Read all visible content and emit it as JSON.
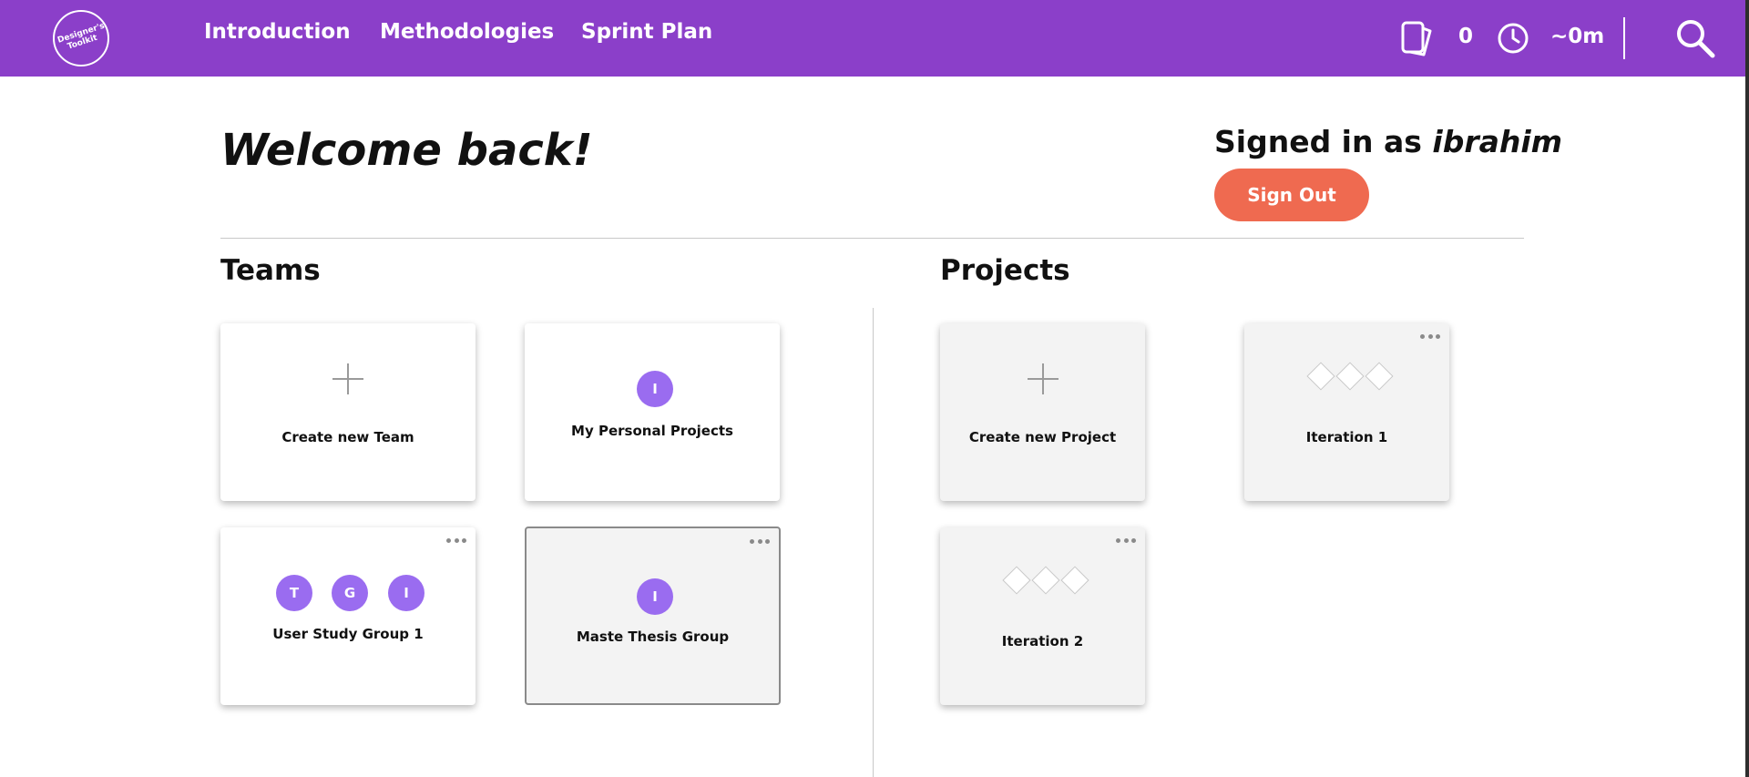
{
  "header": {
    "logo_text": "Designer's Toolkit",
    "nav": [
      "Introduction",
      "Methodologies",
      "Sprint Plan"
    ],
    "card_count": "0",
    "time_estimate": "~0m",
    "icons": [
      "cards-icon",
      "clock-icon",
      "search-icon"
    ]
  },
  "welcome": {
    "title": "Welcome back!",
    "signed_in_prefix": "Signed in as ",
    "username": "ibrahim",
    "sign_out_label": "Sign Out"
  },
  "teams": {
    "title": "Teams",
    "create_label": "Create new Team",
    "items": [
      {
        "name": "My Personal Projects",
        "members": [
          "I"
        ]
      },
      {
        "name": "User Study Group 1",
        "members": [
          "T",
          "G",
          "I"
        ]
      },
      {
        "name": "Maste Thesis Group",
        "members": [
          "I"
        ],
        "selected": true
      }
    ]
  },
  "projects": {
    "title": "Projects",
    "create_label": "Create new Project",
    "items": [
      {
        "name": "Iteration 1"
      },
      {
        "name": "Iteration 2"
      }
    ]
  },
  "colors": {
    "header": "#8b3fc9",
    "sign_out": "#ef6a50",
    "avatar": "#9a6cf0"
  }
}
